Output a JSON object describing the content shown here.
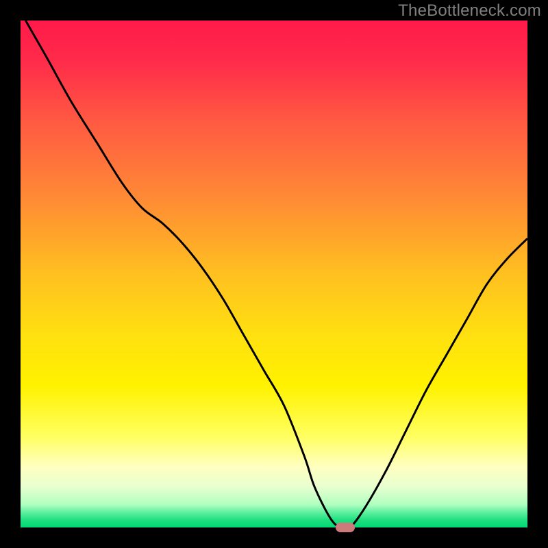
{
  "watermark": "TheBottleneck.com",
  "chart_data": {
    "type": "line",
    "title": "",
    "xlabel": "",
    "ylabel": "",
    "xlim": [
      0,
      100
    ],
    "ylim": [
      0,
      100
    ],
    "background_gradient": [
      {
        "pos": 0.0,
        "color": "#ff1a4a"
      },
      {
        "pos": 0.08,
        "color": "#ff2b4a"
      },
      {
        "pos": 0.2,
        "color": "#ff5a42"
      },
      {
        "pos": 0.35,
        "color": "#ff8a35"
      },
      {
        "pos": 0.5,
        "color": "#ffc020"
      },
      {
        "pos": 0.62,
        "color": "#ffe010"
      },
      {
        "pos": 0.72,
        "color": "#fff200"
      },
      {
        "pos": 0.82,
        "color": "#ffff60"
      },
      {
        "pos": 0.88,
        "color": "#ffffc0"
      },
      {
        "pos": 0.92,
        "color": "#e8ffd0"
      },
      {
        "pos": 0.955,
        "color": "#b0ffc0"
      },
      {
        "pos": 0.97,
        "color": "#60f0a0"
      },
      {
        "pos": 0.985,
        "color": "#20e080"
      },
      {
        "pos": 1.0,
        "color": "#00d873"
      }
    ],
    "series": [
      {
        "name": "bottleneck-curve",
        "color": "#000000",
        "x": [
          1,
          5,
          10,
          15,
          20,
          24,
          28,
          32,
          36,
          40,
          44,
          48,
          52,
          56,
          58,
          61,
          63,
          65,
          68,
          72,
          76,
          80,
          84,
          88,
          92,
          96,
          100
        ],
        "y": [
          100,
          93,
          84,
          76,
          68,
          63,
          60,
          56,
          51,
          45,
          38,
          31,
          24,
          14,
          8,
          2,
          0,
          0,
          4,
          11,
          19,
          27,
          34,
          41,
          48,
          53,
          57
        ]
      }
    ],
    "marker": {
      "x": 64,
      "y": 0,
      "color": "#cd7a7d"
    }
  }
}
